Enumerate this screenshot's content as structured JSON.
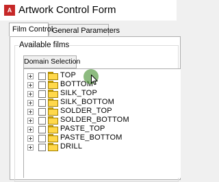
{
  "window": {
    "title": "Artwork Control Form",
    "icon": "app-icon"
  },
  "tabs": [
    {
      "label": "Film Control",
      "active": true
    },
    {
      "label": "General Parameters",
      "active": false
    }
  ],
  "available_films": {
    "group_label": "Available films",
    "domain_button_label": "Domain Selection",
    "items": [
      {
        "label": "TOP",
        "checked": false,
        "expandable": true
      },
      {
        "label": "BOTTOM",
        "checked": false,
        "expandable": true
      },
      {
        "label": "SILK_TOP",
        "checked": false,
        "expandable": true
      },
      {
        "label": "SILK_BOTTOM",
        "checked": false,
        "expandable": true
      },
      {
        "label": "SOLDER_TOP",
        "checked": false,
        "expandable": true
      },
      {
        "label": "SOLDER_BOTTOM",
        "checked": false,
        "expandable": true
      },
      {
        "label": "PASTE_TOP",
        "checked": false,
        "expandable": true
      },
      {
        "label": "PASTE_BOTTOM",
        "checked": false,
        "expandable": true
      },
      {
        "label": "DRILL",
        "checked": false,
        "expandable": true
      }
    ]
  },
  "colors": {
    "folder": "#ffd84a",
    "cursor_highlight": "#5f9a46",
    "app_icon": "#c62828"
  }
}
